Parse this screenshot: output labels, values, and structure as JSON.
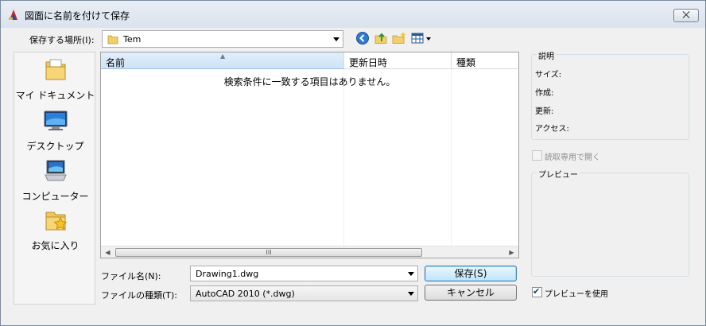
{
  "window": {
    "title": "図面に名前を付けて保存",
    "close_label": "⨉"
  },
  "location": {
    "label": "保存する場所(I):",
    "value": "Tem"
  },
  "toolbar": {
    "icons": [
      "back-icon",
      "up-folder-icon",
      "new-folder-icon",
      "view-menu-icon"
    ]
  },
  "places": [
    {
      "label": "マイ ドキュメント",
      "icon": "my-documents-icon"
    },
    {
      "label": "デスクトップ",
      "icon": "desktop-icon"
    },
    {
      "label": "コンピューター",
      "icon": "computer-icon"
    },
    {
      "label": "お気に入り",
      "icon": "favorites-icon"
    }
  ],
  "file_list": {
    "columns": [
      "名前",
      "更新日時",
      "種類"
    ],
    "empty_message": "検索条件に一致する項目はありません。",
    "scroll_thumb_glyph": "III"
  },
  "filename": {
    "label": "ファイル名(N):",
    "value": "Drawing1.dwg"
  },
  "filetype": {
    "label": "ファイルの種類(T):",
    "value": "AutoCAD 2010 (*.dwg)"
  },
  "buttons": {
    "save": "保存(S)",
    "cancel": "キャンセル"
  },
  "description": {
    "title": "説明",
    "fields": [
      "サイズ:",
      "作成:",
      "更新:",
      "アクセス:"
    ]
  },
  "read_only": {
    "label": "読取専用で開く",
    "checked": false,
    "enabled": false
  },
  "preview": {
    "title": "プレビュー"
  },
  "use_preview": {
    "label": "プレビューを使用",
    "checked": true
  },
  "colors": {
    "accent": "#3c7fb1",
    "selected_header": "#cfe3f8"
  }
}
